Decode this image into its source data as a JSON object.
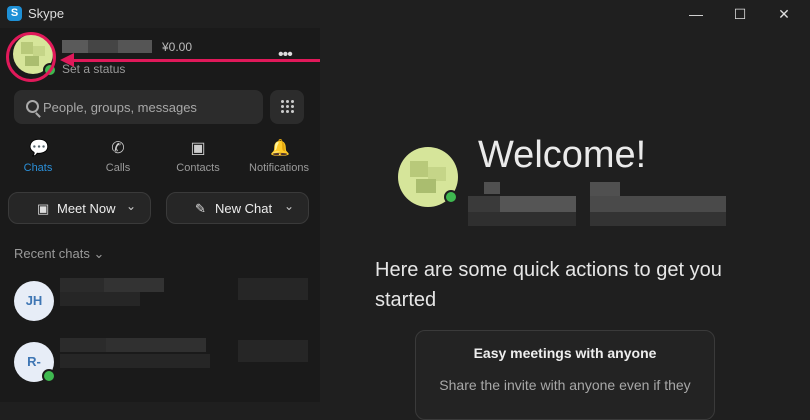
{
  "window": {
    "title": "Skype",
    "app_icon_letter": "S",
    "minimize": "—",
    "maximize": "☐",
    "close": "✕"
  },
  "profile": {
    "balance": "¥0.00",
    "status_placeholder": "Set a status",
    "more": "•••"
  },
  "search": {
    "placeholder": "People, groups, messages"
  },
  "tabs": [
    {
      "label": "Chats",
      "icon": "💬"
    },
    {
      "label": "Calls",
      "icon": "✆"
    },
    {
      "label": "Contacts",
      "icon": "▣"
    },
    {
      "label": "Notifications",
      "icon": "🔔"
    }
  ],
  "actions": {
    "meet_now": "Meet Now",
    "new_chat": "New Chat",
    "chevron": "⌄"
  },
  "recent": {
    "heading": "Recent chats ⌄",
    "chats": [
      {
        "initials": "JH"
      },
      {
        "initials": "R-"
      }
    ]
  },
  "welcome": {
    "title": "Welcome!",
    "quick_actions": "Here are some quick actions to get you started",
    "card": {
      "title": "Easy meetings with anyone",
      "text": "Share the invite with anyone even if they"
    }
  },
  "colors": {
    "accent": "#2b8fd8",
    "annotation": "#e0195a",
    "online": "#3fb950"
  }
}
